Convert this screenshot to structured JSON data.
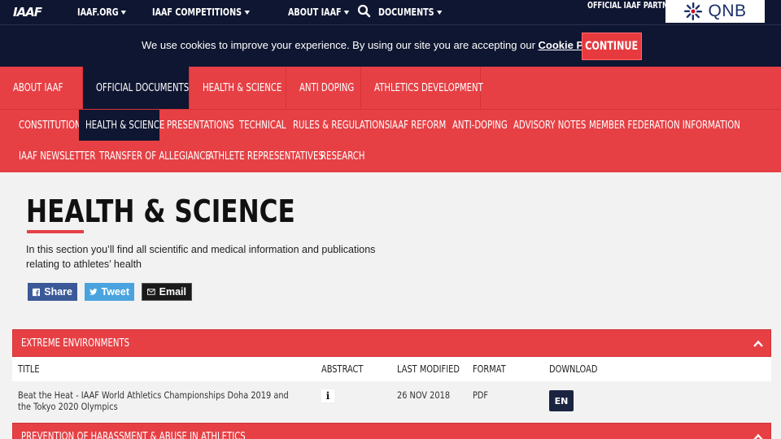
{
  "topbar": {
    "logo": "IAAF",
    "nav": [
      "IAAF.ORG",
      "IAAF COMPETITIONS",
      "ABOUT IAAF",
      "DOCUMENTS"
    ],
    "partner_label": "OFFICIAL IAAF PARTNER",
    "partner_name": "QNB"
  },
  "cookie": {
    "text": "We use cookies to improve your experience. By using our site you are accepting our ",
    "link": "Cookie Policy",
    "button": "CONTINUE"
  },
  "nav_primary": [
    {
      "label": "ABOUT IAAF",
      "active": false
    },
    {
      "label": "OFFICIAL DOCUMENTS",
      "active": true
    },
    {
      "label": "HEALTH & SCIENCE",
      "active": false
    },
    {
      "label": "ANTI DOPING",
      "active": false
    },
    {
      "label": "ATHLETICS DEVELOPMENT",
      "active": false
    }
  ],
  "nav_secondary": [
    {
      "label": "CONSTITUTION",
      "active": false
    },
    {
      "label": "HEALTH & SCIENCE",
      "active": true
    },
    {
      "label": "PRESENTATIONS",
      "active": false
    },
    {
      "label": "TECHNICAL",
      "active": false
    },
    {
      "label": "RULES & REGULATIONS",
      "active": false
    },
    {
      "label": "IAAF REFORM",
      "active": false
    },
    {
      "label": "ANTI-DOPING",
      "active": false
    },
    {
      "label": "ADVISORY NOTES",
      "active": false
    },
    {
      "label": "MEMBER FEDERATION INFORMATION",
      "active": false
    },
    {
      "label": "IAAF NEWSLETTER",
      "active": false
    },
    {
      "label": "TRANSFER OF ALLEGIANCE",
      "active": false
    },
    {
      "label": "ATHLETE REPRESENTATIVES",
      "active": false
    },
    {
      "label": "RESEARCH",
      "active": false
    }
  ],
  "page": {
    "title": "HEALTH & SCIENCE",
    "intro": "In this section you’ll find all scientific and medical information and publications relating to athletes’ health"
  },
  "share": {
    "share": "Share",
    "tweet": "Tweet",
    "email": "Email"
  },
  "sections": [
    {
      "title": "EXTREME ENVIRONMENTS",
      "columns": [
        "TITLE",
        "ABSTRACT",
        "LAST MODIFIED",
        "FORMAT",
        "DOWNLOAD"
      ],
      "rows": [
        {
          "title": "Beat the Heat - IAAF World Athletics Championships Doha 2019 and the Tokyo 2020 Olympics",
          "abstract_icon": "info-icon",
          "modified": "26 NOV 2018",
          "format": "PDF",
          "download": "EN"
        }
      ]
    },
    {
      "title": "PREVENTION OF HARASSMENT & ABUSE IN ATHLETICS"
    }
  ],
  "colors": {
    "navy": "#0f1631",
    "red": "#e64045",
    "facebook": "#3b5998",
    "twitter": "#4aa3df",
    "email": "#1a1a1a"
  }
}
